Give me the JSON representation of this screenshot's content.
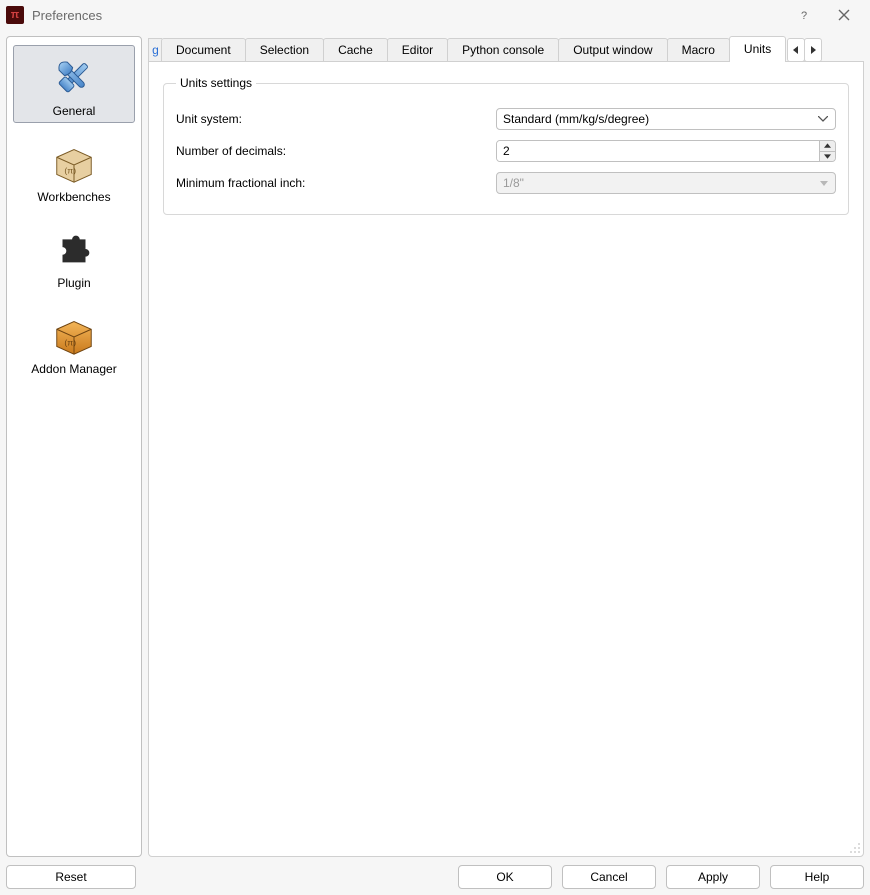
{
  "window": {
    "title": "Preferences"
  },
  "sidebar": {
    "items": [
      {
        "label": "General"
      },
      {
        "label": "Workbenches"
      },
      {
        "label": "Plugin"
      },
      {
        "label": "Addon Manager"
      }
    ],
    "selected_index": 0
  },
  "tabs": {
    "overflow_hint": "g",
    "items": [
      {
        "label": "Document"
      },
      {
        "label": "Selection"
      },
      {
        "label": "Cache"
      },
      {
        "label": "Editor"
      },
      {
        "label": "Python console"
      },
      {
        "label": "Output window"
      },
      {
        "label": "Macro"
      },
      {
        "label": "Units"
      }
    ],
    "active_index": 7
  },
  "page": {
    "group_title": "Units settings",
    "unit_system": {
      "label": "Unit system:",
      "value": "Standard (mm/kg/s/degree)"
    },
    "decimals": {
      "label": "Number of decimals:",
      "value": "2"
    },
    "min_fractional": {
      "label": "Minimum fractional inch:",
      "value": "1/8\"",
      "enabled": false
    }
  },
  "buttons": {
    "reset": "Reset",
    "ok": "OK",
    "cancel": "Cancel",
    "apply": "Apply",
    "help": "Help"
  }
}
